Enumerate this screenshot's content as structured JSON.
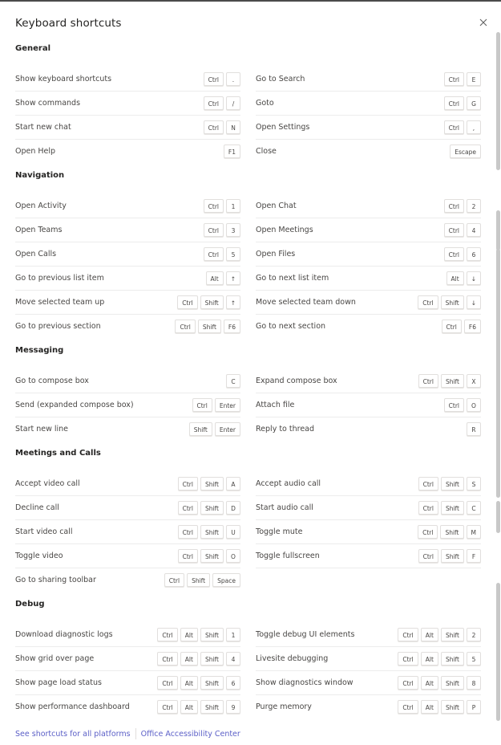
{
  "dialog": {
    "title": "Keyboard shortcuts",
    "close_icon": "close-icon"
  },
  "sections": [
    {
      "title": "General",
      "left": [
        {
          "label": "Show keyboard shortcuts",
          "keys": [
            "Ctrl",
            "."
          ]
        },
        {
          "label": "Show commands",
          "keys": [
            "Ctrl",
            "/"
          ]
        },
        {
          "label": "Start new chat",
          "keys": [
            "Ctrl",
            "N"
          ]
        },
        {
          "label": "Open Help",
          "keys": [
            "F1"
          ]
        }
      ],
      "right": [
        {
          "label": "Go to Search",
          "keys": [
            "Ctrl",
            "E"
          ]
        },
        {
          "label": "Goto",
          "keys": [
            "Ctrl",
            "G"
          ]
        },
        {
          "label": "Open Settings",
          "keys": [
            "Ctrl",
            ","
          ]
        },
        {
          "label": "Close",
          "keys": [
            "Escape"
          ]
        }
      ]
    },
    {
      "title": "Navigation",
      "left": [
        {
          "label": "Open Activity",
          "keys": [
            "Ctrl",
            "1"
          ]
        },
        {
          "label": "Open Teams",
          "keys": [
            "Ctrl",
            "3"
          ]
        },
        {
          "label": "Open Calls",
          "keys": [
            "Ctrl",
            "5"
          ]
        },
        {
          "label": "Go to previous list item",
          "keys": [
            "Alt",
            "↑"
          ]
        },
        {
          "label": "Move selected team up",
          "keys": [
            "Ctrl",
            "Shift",
            "↑"
          ]
        },
        {
          "label": "Go to previous section",
          "keys": [
            "Ctrl",
            "Shift",
            "F6"
          ]
        }
      ],
      "right": [
        {
          "label": "Open Chat",
          "keys": [
            "Ctrl",
            "2"
          ]
        },
        {
          "label": "Open Meetings",
          "keys": [
            "Ctrl",
            "4"
          ]
        },
        {
          "label": "Open Files",
          "keys": [
            "Ctrl",
            "6"
          ]
        },
        {
          "label": "Go to next list item",
          "keys": [
            "Alt",
            "↓"
          ]
        },
        {
          "label": "Move selected team down",
          "keys": [
            "Ctrl",
            "Shift",
            "↓"
          ]
        },
        {
          "label": "Go to next section",
          "keys": [
            "Ctrl",
            "F6"
          ]
        }
      ]
    },
    {
      "title": "Messaging",
      "left": [
        {
          "label": "Go to compose box",
          "keys": [
            "C"
          ]
        },
        {
          "label": "Send (expanded compose box)",
          "keys": [
            "Ctrl",
            "Enter"
          ]
        },
        {
          "label": "Start new line",
          "keys": [
            "Shift",
            "Enter"
          ]
        }
      ],
      "right": [
        {
          "label": "Expand compose box",
          "keys": [
            "Ctrl",
            "Shift",
            "X"
          ]
        },
        {
          "label": "Attach file",
          "keys": [
            "Ctrl",
            "O"
          ]
        },
        {
          "label": "Reply to thread",
          "keys": [
            "R"
          ]
        }
      ]
    },
    {
      "title": "Meetings and Calls",
      "left": [
        {
          "label": "Accept video call",
          "keys": [
            "Ctrl",
            "Shift",
            "A"
          ]
        },
        {
          "label": "Decline call",
          "keys": [
            "Ctrl",
            "Shift",
            "D"
          ]
        },
        {
          "label": "Start video call",
          "keys": [
            "Ctrl",
            "Shift",
            "U"
          ]
        },
        {
          "label": "Toggle video",
          "keys": [
            "Ctrl",
            "Shift",
            "O"
          ]
        },
        {
          "label": "Go to sharing toolbar",
          "keys": [
            "Ctrl",
            "Shift",
            "Space"
          ]
        }
      ],
      "right": [
        {
          "label": "Accept audio call",
          "keys": [
            "Ctrl",
            "Shift",
            "S"
          ]
        },
        {
          "label": "Start audio call",
          "keys": [
            "Ctrl",
            "Shift",
            "C"
          ]
        },
        {
          "label": "Toggle mute",
          "keys": [
            "Ctrl",
            "Shift",
            "M"
          ]
        },
        {
          "label": "Toggle fullscreen",
          "keys": [
            "Ctrl",
            "Shift",
            "F"
          ]
        }
      ]
    },
    {
      "title": "Debug",
      "left": [
        {
          "label": "Download diagnostic logs",
          "keys": [
            "Ctrl",
            "Alt",
            "Shift",
            "1"
          ]
        },
        {
          "label": "Show grid over page",
          "keys": [
            "Ctrl",
            "Alt",
            "Shift",
            "4"
          ]
        },
        {
          "label": "Show page load status",
          "keys": [
            "Ctrl",
            "Alt",
            "Shift",
            "6"
          ]
        },
        {
          "label": "Show performance dashboard",
          "keys": [
            "Ctrl",
            "Alt",
            "Shift",
            "9"
          ]
        }
      ],
      "right": [
        {
          "label": "Toggle debug UI elements",
          "keys": [
            "Ctrl",
            "Alt",
            "Shift",
            "2"
          ]
        },
        {
          "label": "Livesite debugging",
          "keys": [
            "Ctrl",
            "Alt",
            "Shift",
            "5"
          ]
        },
        {
          "label": "Show diagnostics window",
          "keys": [
            "Ctrl",
            "Alt",
            "Shift",
            "8"
          ]
        },
        {
          "label": "Purge memory",
          "keys": [
            "Ctrl",
            "Alt",
            "Shift",
            "P"
          ]
        }
      ]
    }
  ],
  "footer": {
    "link_all_platforms": "See shortcuts for all platforms",
    "link_accessibility": "Office Accessibility Center",
    "link_color": "#5b5fc7"
  }
}
